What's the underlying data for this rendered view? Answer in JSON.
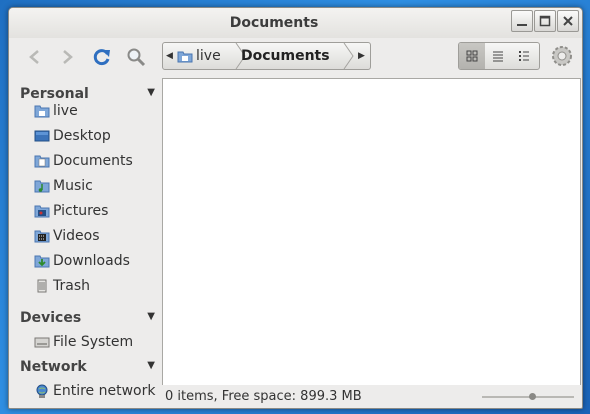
{
  "window": {
    "title": "Documents"
  },
  "toolbar": {
    "back_icon": "back-arrow-icon",
    "forward_icon": "forward-arrow-icon",
    "reload_icon": "reload-icon",
    "search_icon": "search-icon",
    "settings_icon": "gear-icon"
  },
  "pathbar": {
    "crumbs": [
      {
        "label": "live"
      },
      {
        "label": "Documents"
      }
    ]
  },
  "view_modes": [
    "icon-view",
    "list-view",
    "compact-view"
  ],
  "sidebar": {
    "sections": [
      {
        "label": "Personal",
        "items": [
          "live",
          "Desktop",
          "Documents",
          "Music",
          "Pictures",
          "Videos",
          "Downloads",
          "Trash"
        ]
      },
      {
        "label": "Devices",
        "items": [
          "File System"
        ]
      },
      {
        "label": "Network",
        "items": [
          "Entire network"
        ]
      }
    ]
  },
  "status": {
    "text": "0 items, Free space: 899.3 MB",
    "zoom_level": 0.55
  },
  "colors": {
    "desktop": "#2a7fd6",
    "window_bg": "#edeceb",
    "accent_blue": "#3f7bc6"
  }
}
